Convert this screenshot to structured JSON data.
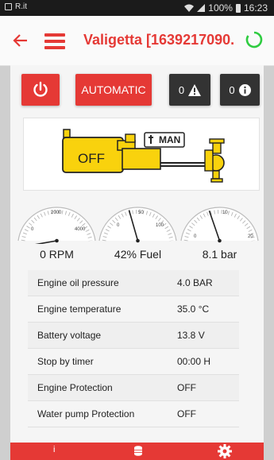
{
  "status_bar": {
    "left_text": "R.it",
    "battery": "100%",
    "time": "16:23"
  },
  "header": {
    "title": "Valigetta [1639217090..."
  },
  "controls": {
    "automatic_label": "AUTOMATIC",
    "warnings_count": "0",
    "info_count": "0"
  },
  "engine": {
    "state_label": "OFF",
    "mode_label": "MAN"
  },
  "gauges": [
    {
      "id": "rpm",
      "value_label": "0 RPM",
      "ticks": [
        "0",
        "2000",
        "4000"
      ],
      "value": 0,
      "max": 4000
    },
    {
      "id": "fuel",
      "value_label": "42% Fuel",
      "ticks": [
        "0",
        "50",
        "100"
      ],
      "value": 42,
      "max": 100
    },
    {
      "id": "pressure",
      "value_label": "8.1 bar",
      "ticks": [
        "0",
        "10",
        "20"
      ],
      "value": 8.1,
      "max": 20
    }
  ],
  "params": [
    {
      "label": "Engine oil pressure",
      "value": "4.0 BAR"
    },
    {
      "label": "Engine temperature",
      "value": "35.0 °C"
    },
    {
      "label": "Battery voltage",
      "value": "13.8 V"
    },
    {
      "label": "Stop by timer",
      "value": "00:00 H"
    },
    {
      "label": "Engine Protection",
      "value": "OFF"
    },
    {
      "label": "Water pump Protection",
      "value": "OFF"
    }
  ],
  "bottom_nav": {
    "info_glyph": "i"
  },
  "colors": {
    "accent": "#e53935",
    "dark_button": "#333333",
    "engine_yellow": "#f9d20d",
    "refresh_green": "#2ecc40"
  }
}
